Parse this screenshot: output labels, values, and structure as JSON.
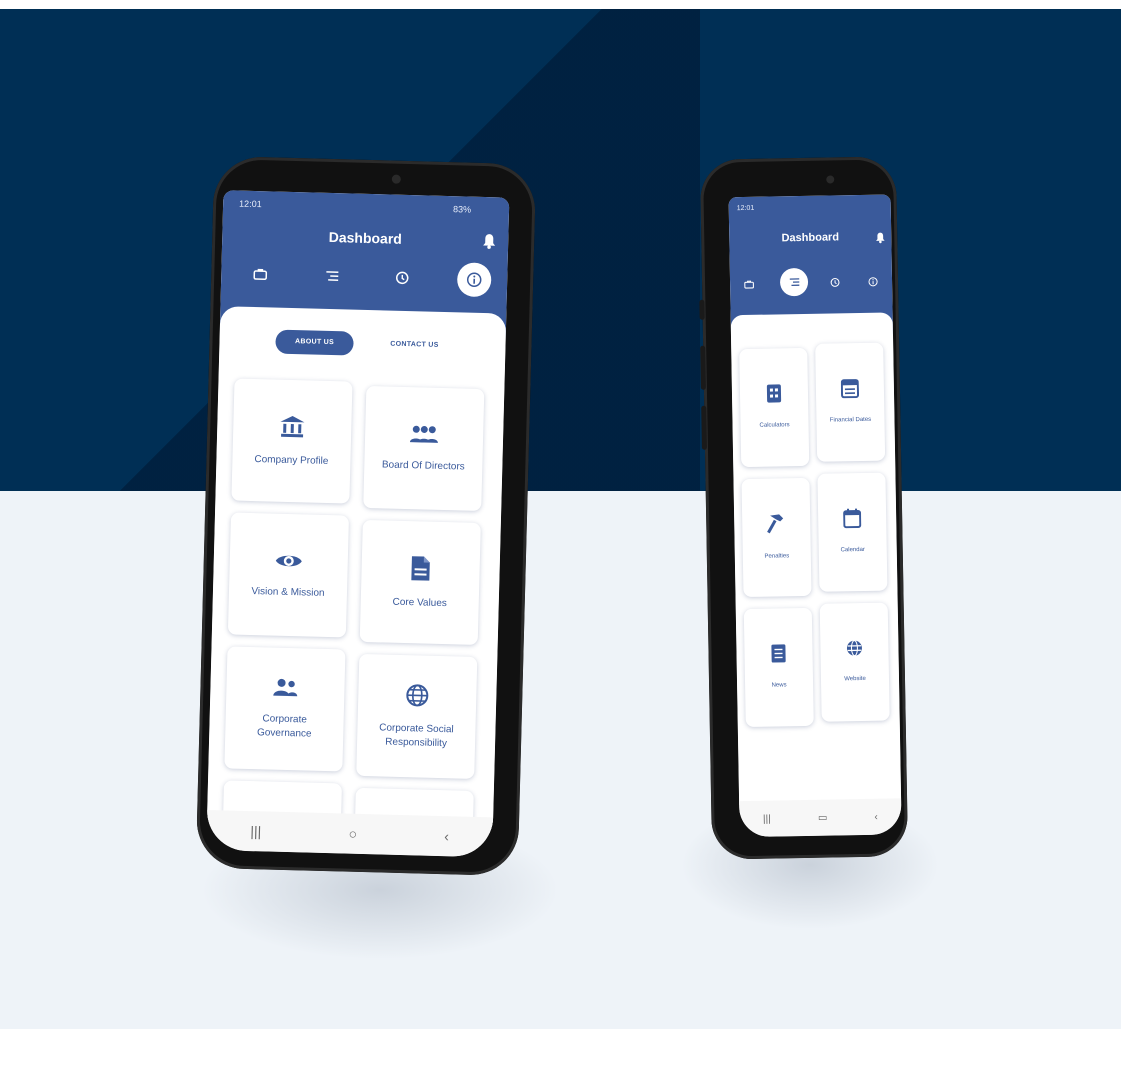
{
  "colors": {
    "primary": "#3a5a9b",
    "bg_dark": "#002f55",
    "bg_light": "#eef3f8"
  },
  "left_phone": {
    "status_time": "12:01",
    "status_right": "83%",
    "title": "Dashboard",
    "icons": {
      "bell": "bell-icon",
      "nav": [
        "briefcase-icon",
        "list-icon",
        "clock-icon",
        "info-icon"
      ]
    },
    "tabs": [
      {
        "label": "ABOUT US",
        "active": true
      },
      {
        "label": "CONTACT US",
        "active": false
      }
    ],
    "cards": [
      {
        "label": "Company Profile",
        "icon": "bank-icon"
      },
      {
        "label": "Board Of Directors",
        "icon": "group-icon"
      },
      {
        "label": "Vision & Mission",
        "icon": "eye-icon"
      },
      {
        "label": "Core Values",
        "icon": "document-icon"
      },
      {
        "label": "Corporate Governance",
        "icon": "people-icon"
      },
      {
        "label": "Corporate Social Responsibility",
        "icon": "globe-icon"
      }
    ],
    "navbar": [
      "|||",
      "○",
      "‹"
    ]
  },
  "right_phone": {
    "status_time": "12:01",
    "title": "Dashboard",
    "cards": [
      {
        "label": "Calculators",
        "icon": "calculator-icon"
      },
      {
        "label": "Financial Dates",
        "icon": "calendar-list-icon"
      },
      {
        "label": "Penalties",
        "icon": "hammer-icon"
      },
      {
        "label": "Calendar",
        "icon": "calendar-icon"
      },
      {
        "label": "News",
        "icon": "news-icon"
      },
      {
        "label": "Website",
        "icon": "web-icon"
      }
    ],
    "navbar": [
      "|||",
      "▭",
      "‹"
    ]
  }
}
